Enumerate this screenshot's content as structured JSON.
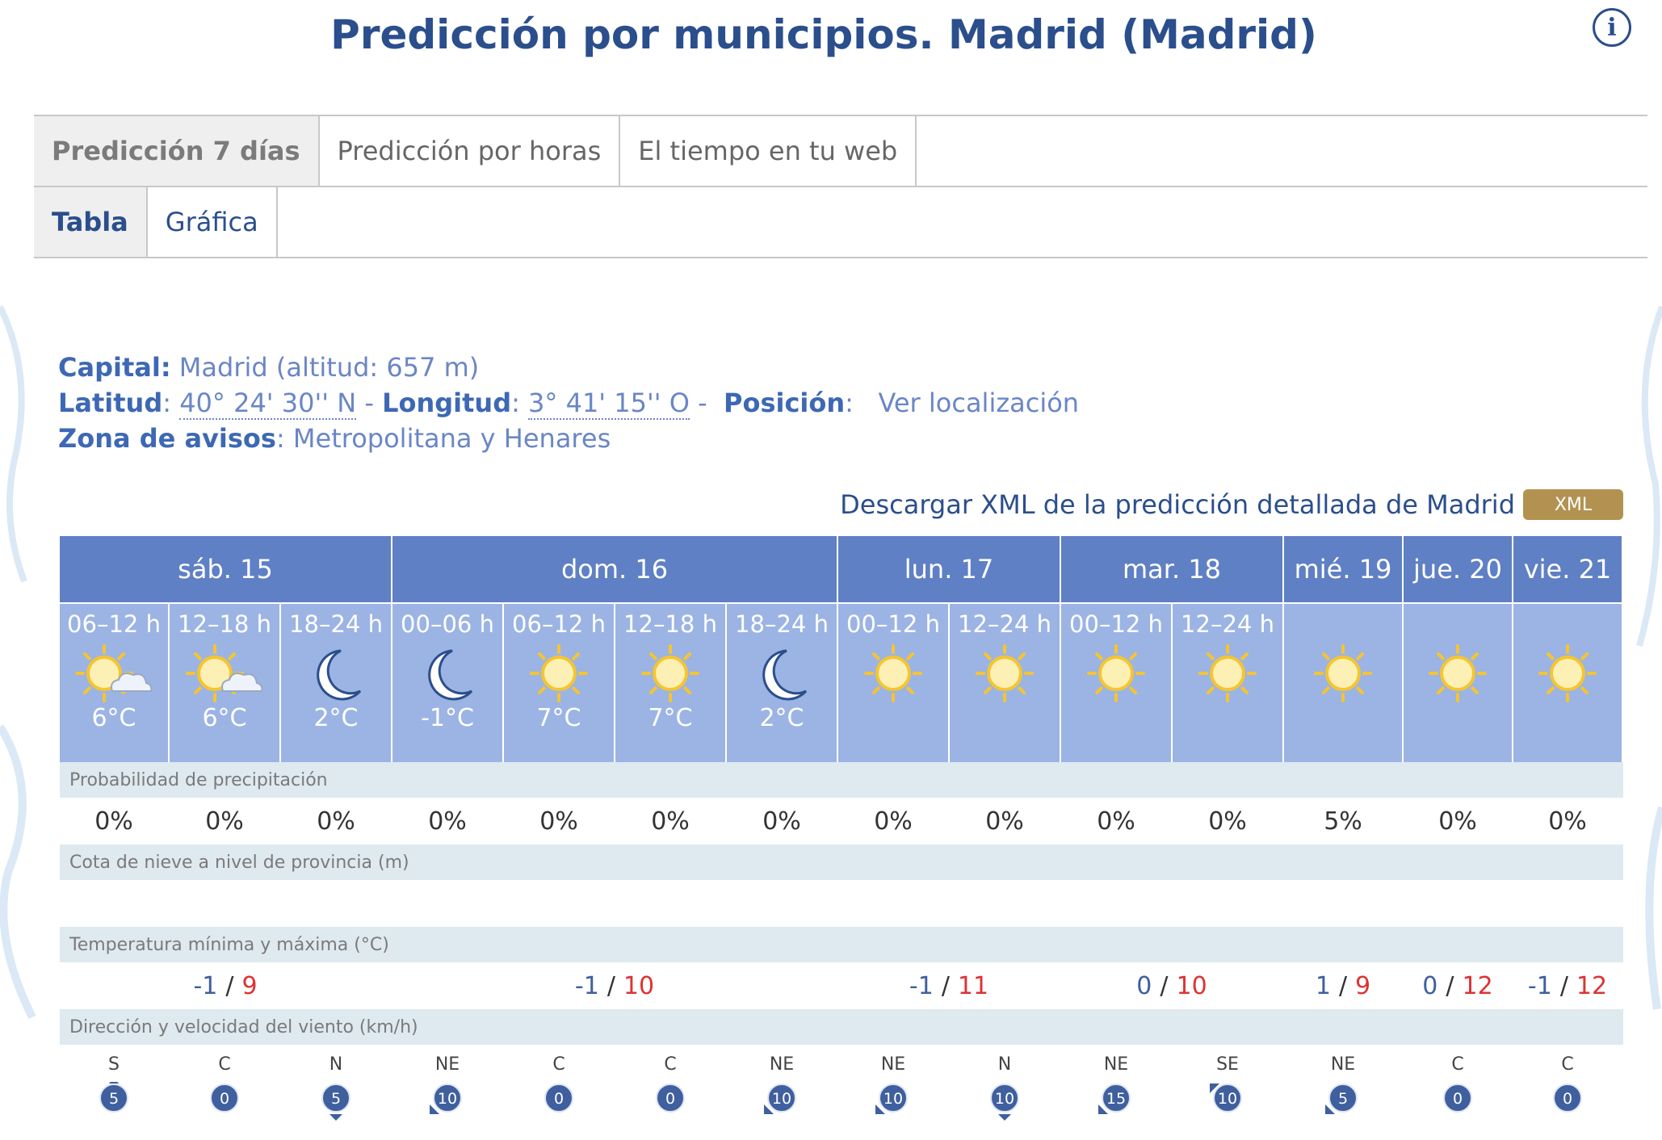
{
  "title": "Predicción por municipios. Madrid (Madrid)",
  "info_icon": "info-icon",
  "tabs": [
    {
      "label": "Predicción 7 días",
      "active": true
    },
    {
      "label": "Predicción por horas",
      "active": false
    },
    {
      "label": "El tiempo en tu web",
      "active": false
    }
  ],
  "subtabs": [
    {
      "label": "Tabla",
      "active": true
    },
    {
      "label": "Gráfica",
      "active": false
    }
  ],
  "location": {
    "capital_label": "Capital:",
    "capital_value": "Madrid (altitud: 657 m)",
    "lat_label": "Latitud",
    "lat_value": "40° 24' 30'' N",
    "lon_label": "Longitud",
    "lon_value": "3° 41' 15'' O",
    "pos_label": "Posición",
    "pos_link": "Ver localización",
    "zone_label": "Zona de avisos",
    "zone_value": "Metropolitana y Henares"
  },
  "download": {
    "text": "Descargar XML de la predicción detallada de Madrid",
    "button": "XML"
  },
  "days": [
    {
      "label": "sáb. 15",
      "span": 3,
      "tmin": "-1",
      "tmax": "9"
    },
    {
      "label": "dom. 16",
      "span": 4,
      "tmin": "-1",
      "tmax": "10"
    },
    {
      "label": "lun. 17",
      "span": 2,
      "tmin": "-1",
      "tmax": "11"
    },
    {
      "label": "mar. 18",
      "span": 2,
      "tmin": "0",
      "tmax": "10"
    },
    {
      "label": "mié. 19",
      "span": 1,
      "tmin": "1",
      "tmax": "9"
    },
    {
      "label": "jue. 20",
      "span": 1,
      "tmin": "0",
      "tmax": "12"
    },
    {
      "label": "vie. 21",
      "span": 1,
      "tmin": "-1",
      "tmax": "12"
    }
  ],
  "periods": [
    {
      "label": "06–12 h",
      "icon": "sun-cloud-icon",
      "temp": "6°C",
      "precip": "0%",
      "wind_dir": "S",
      "wind_speed": "5",
      "arrow": "s"
    },
    {
      "label": "12–18 h",
      "icon": "sun-cloud-icon",
      "temp": "6°C",
      "precip": "0%",
      "wind_dir": "C",
      "wind_speed": "0",
      "arrow": ""
    },
    {
      "label": "18–24 h",
      "icon": "moon-icon",
      "temp": "2°C",
      "precip": "0%",
      "wind_dir": "N",
      "wind_speed": "5",
      "arrow": "n"
    },
    {
      "label": "00–06 h",
      "icon": "moon-icon",
      "temp": "-1°C",
      "precip": "0%",
      "wind_dir": "NE",
      "wind_speed": "10",
      "arrow": "ne"
    },
    {
      "label": "06–12 h",
      "icon": "sun-icon",
      "temp": "7°C",
      "precip": "0%",
      "wind_dir": "C",
      "wind_speed": "0",
      "arrow": ""
    },
    {
      "label": "12–18 h",
      "icon": "sun-icon",
      "temp": "7°C",
      "precip": "0%",
      "wind_dir": "C",
      "wind_speed": "0",
      "arrow": ""
    },
    {
      "label": "18–24 h",
      "icon": "moon-icon",
      "temp": "2°C",
      "precip": "0%",
      "wind_dir": "NE",
      "wind_speed": "10",
      "arrow": "ne"
    },
    {
      "label": "00–12 h",
      "icon": "sun-icon",
      "temp": "",
      "precip": "0%",
      "wind_dir": "NE",
      "wind_speed": "10",
      "arrow": "ne"
    },
    {
      "label": "12–24 h",
      "icon": "sun-icon",
      "temp": "",
      "precip": "0%",
      "wind_dir": "N",
      "wind_speed": "10",
      "arrow": "n"
    },
    {
      "label": "00–12 h",
      "icon": "sun-icon",
      "temp": "",
      "precip": "0%",
      "wind_dir": "NE",
      "wind_speed": "15",
      "arrow": "ne"
    },
    {
      "label": "12–24 h",
      "icon": "sun-icon",
      "temp": "",
      "precip": "0%",
      "wind_dir": "SE",
      "wind_speed": "10",
      "arrow": "se"
    },
    {
      "label": "",
      "icon": "sun-icon",
      "temp": "",
      "precip": "5%",
      "wind_dir": "NE",
      "wind_speed": "5",
      "arrow": "ne"
    },
    {
      "label": "",
      "icon": "sun-icon",
      "temp": "",
      "precip": "0%",
      "wind_dir": "C",
      "wind_speed": "0",
      "arrow": ""
    },
    {
      "label": "",
      "icon": "sun-icon",
      "temp": "",
      "precip": "0%",
      "wind_dir": "C",
      "wind_speed": "0",
      "arrow": ""
    }
  ],
  "sections": {
    "precip": "Probabilidad de precipitación",
    "snow": "Cota de nieve a nivel de provincia (m)",
    "temp": "Temperatura mínima y máxima (°C)",
    "wind": "Dirección y velocidad del viento (km/h)"
  },
  "colors": {
    "title": "#2b4e8c",
    "header_dark": "#5f80c4",
    "header_light": "#9cb4e4",
    "section_bg": "#dfe9f0",
    "tmax": "#dd3333",
    "wind_badge": "#3f5f9e",
    "xml_button": "#b39251"
  }
}
